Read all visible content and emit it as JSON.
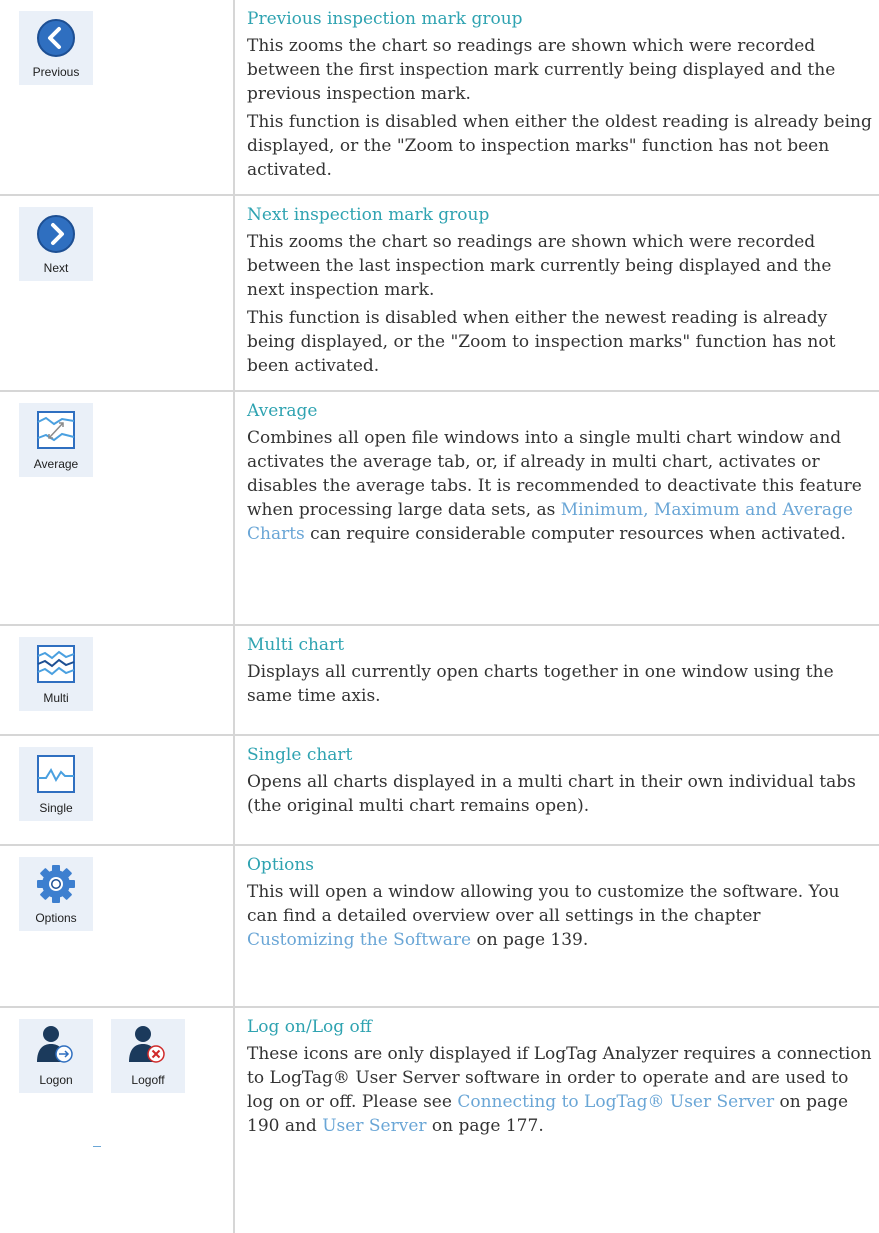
{
  "rows": [
    {
      "icon_label": "Previous",
      "title": "Previous inspection mark group",
      "p1": "This zooms the chart so readings are shown which were recorded between the first inspection mark currently being displayed and the previous inspection mark.",
      "p2": "This function is disabled when either the oldest reading is already being displayed, or the \"Zoom to inspection marks\" function has not been activated."
    },
    {
      "icon_label": "Next",
      "title": "Next inspection mark group",
      "p1": "This zooms the chart so readings are shown which were recorded between the last inspection mark currently being displayed and the next inspection mark.",
      "p2": "This function is disabled when either the newest reading is already being displayed, or the \"Zoom to inspection marks\" function has not been activated."
    },
    {
      "icon_label": "Average",
      "title": "Average",
      "p1_a": "Combines all open file windows into a single multi chart window and activates the average tab, or, if already in multi chart, activates or disables the average tabs. It is recommended to deactivate this feature when processing large data sets, as ",
      "p1_link": "Minimum, Maximum and Average Charts",
      "p1_b": " can require considerable computer resources when activated."
    },
    {
      "icon_label": "Multi",
      "title": "Multi chart",
      "p1": "Displays all currently open charts together in one window using the same time axis."
    },
    {
      "icon_label": "Single",
      "title": "Single chart",
      "p1": "Opens all charts displayed in a multi chart in their own individual tabs (the original multi chart remains open)."
    },
    {
      "icon_label": "Options",
      "title": "Options",
      "p1_a": "This will open a window allowing you to customize the software. You can find a detailed overview over all settings in the chapter ",
      "p1_link": "Customizing the Software",
      "p1_b": " on page 139."
    },
    {
      "icon_label_1": "Logon",
      "icon_label_2": "Logoff",
      "title": "Log on/Log off",
      "p1_a": "These icons are only displayed if LogTag Analyzer requires a connection to LogTag® User Server software in order to operate and are used to log on or off. Please see ",
      "p1_link1": "Connecting to LogTag® User Server",
      "p1_b": " on page 190 and ",
      "p1_link2": "User Server",
      "p1_c": " on page 177."
    }
  ],
  "colors": {
    "title": "#2fa3b1",
    "body_text": "#333333",
    "link": "#6aa6d6",
    "icon_tile_bg": "#eaf0f8",
    "icon_blue": "#2f6fc0",
    "user_icon": "#1b3a5c",
    "gear": "#3d7fcf"
  },
  "icons": [
    "chevron-left-circle-icon",
    "chevron-right-circle-icon",
    "average-chart-icon",
    "multi-chart-icon",
    "single-chart-icon",
    "gear-icon",
    "user-logon-icon",
    "user-logoff-icon"
  ]
}
